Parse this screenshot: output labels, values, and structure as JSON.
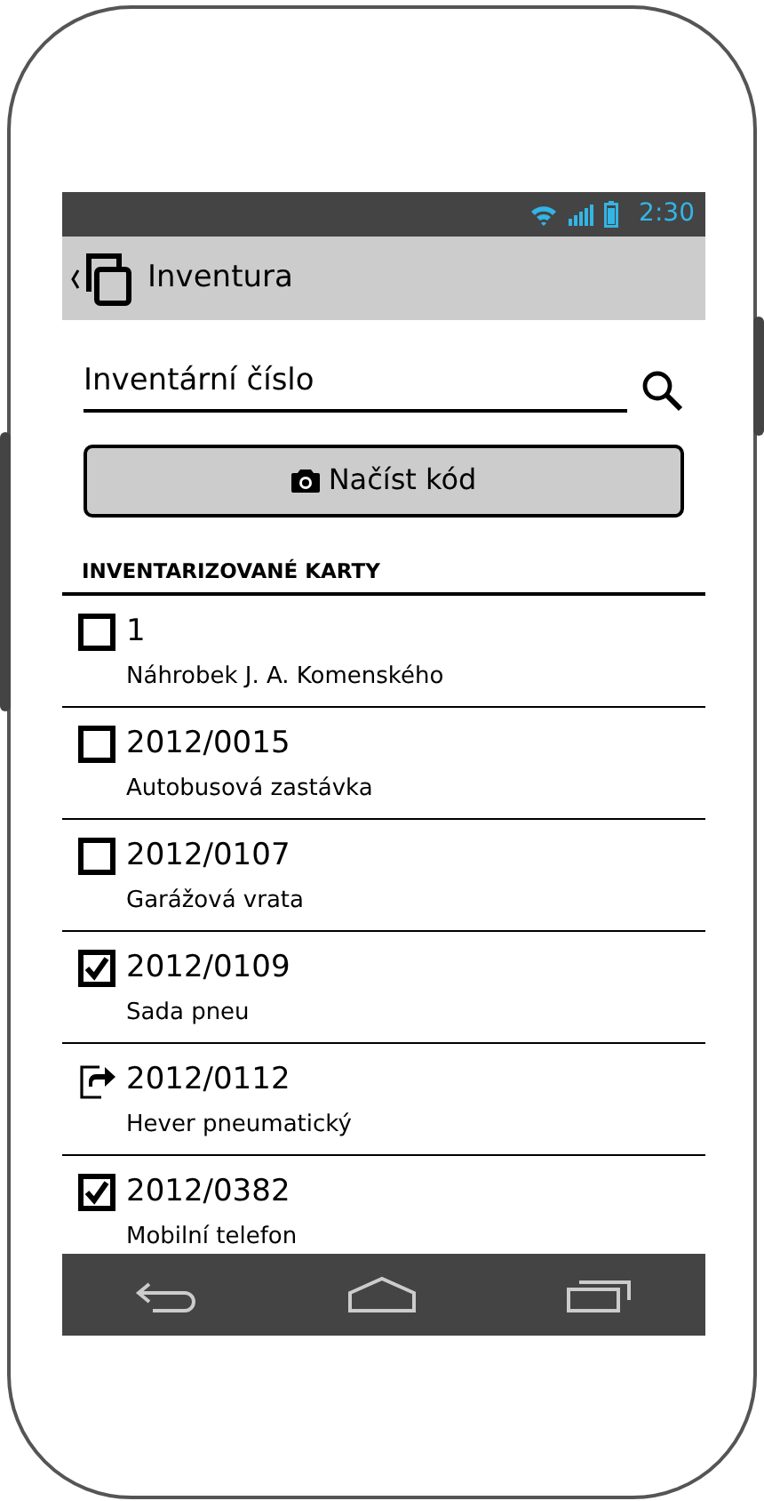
{
  "status_bar": {
    "time": "2:30"
  },
  "app_bar": {
    "title": "Inventura"
  },
  "search": {
    "placeholder": "Inventární číslo"
  },
  "scan_button": {
    "label": "Načíst kód"
  },
  "section": {
    "title": "INVENTARIZOVANÉ KARTY"
  },
  "items": [
    {
      "kind": "checkbox",
      "checked": false,
      "number": "1",
      "name": "Náhrobek J. A. Komenského"
    },
    {
      "kind": "checkbox",
      "checked": false,
      "number": "2012/0015",
      "name": "Autobusová zastávka"
    },
    {
      "kind": "checkbox",
      "checked": false,
      "number": "2012/0107",
      "name": "Garážová vrata"
    },
    {
      "kind": "checkbox",
      "checked": true,
      "number": "2012/0109",
      "name": "Sada pneu"
    },
    {
      "kind": "moved",
      "number": "2012/0112",
      "name": "Hever pneumatický"
    },
    {
      "kind": "checkbox",
      "checked": true,
      "number": "2012/0382",
      "name": "Mobilní telefon"
    }
  ]
}
